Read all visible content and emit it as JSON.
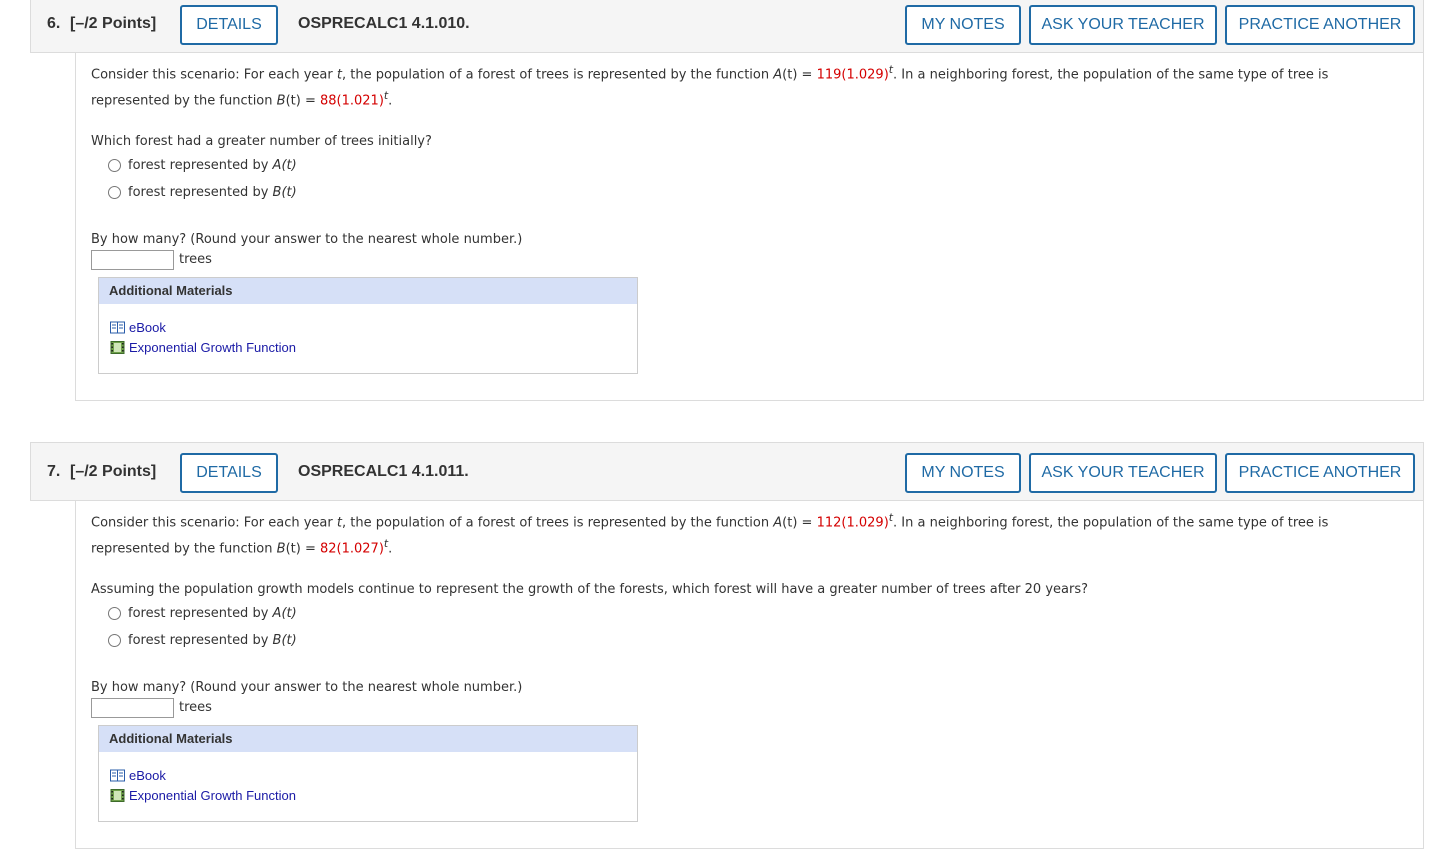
{
  "questions": [
    {
      "number": "6.",
      "points": "[–/2 Points]",
      "details_label": "DETAILS",
      "code": "OSPRECALC1 4.1.010.",
      "my_notes_label": "MY NOTES",
      "ask_teacher_label": "ASK YOUR TEACHER",
      "practice_label": "PRACTICE ANOTHER",
      "scenario": {
        "lead": "Consider this scenario: For each year ",
        "var_t": "t",
        "mid": ", the population of a forest of trees is represented by the function ",
        "fa_name": "A",
        "fa_arg": "(t)",
        "eq": " = ",
        "fa_coef": "119",
        "fa_base": "(1.029)",
        "exp_t": "t",
        "mid2": ".  In a neighboring forest, the population of the same type of tree is",
        "line2_lead": "represented by the function  ",
        "fb_name": "B",
        "fb_arg": "(t)",
        "fb_coef": "88",
        "fb_base": "(1.021)",
        "end": "."
      },
      "prompt": "Which forest had a greater number of trees initially?",
      "options": [
        {
          "text": "forest represented by ",
          "fn": "A(t)"
        },
        {
          "text": "forest represented by ",
          "fn": "B(t)"
        }
      ],
      "how_many": "By how many? (Round your answer to the nearest whole number.)",
      "answer_value": "",
      "unit": "trees",
      "additional_title": "Additional Materials",
      "materials": [
        {
          "label": "eBook",
          "icon": "book-icon"
        },
        {
          "label": "Exponential Growth Function",
          "icon": "film-icon"
        }
      ]
    },
    {
      "number": "7.",
      "points": "[–/2 Points]",
      "details_label": "DETAILS",
      "code": "OSPRECALC1 4.1.011.",
      "my_notes_label": "MY NOTES",
      "ask_teacher_label": "ASK YOUR TEACHER",
      "practice_label": "PRACTICE ANOTHER",
      "scenario": {
        "lead": "Consider this scenario: For each year ",
        "var_t": "t",
        "mid": ", the population of a forest of trees is represented by the function ",
        "fa_name": "A",
        "fa_arg": "(t)",
        "eq": " = ",
        "fa_coef": "112",
        "fa_base": "(1.029)",
        "exp_t": "t",
        "mid2": ".  In a neighboring forest, the population of the same type of tree is",
        "line2_lead": "represented by the function  ",
        "fb_name": "B",
        "fb_arg": "(t)",
        "fb_coef": "82",
        "fb_base": "(1.027)",
        "end": "."
      },
      "prompt": "Assuming the population growth models continue to represent the growth of the forests, which forest will have a greater number of trees after 20 years?",
      "options": [
        {
          "text": "forest represented by ",
          "fn": "A(t)"
        },
        {
          "text": "forest represented by ",
          "fn": "B(t)"
        }
      ],
      "how_many": "By how many? (Round your answer to the nearest whole number.)",
      "answer_value": "",
      "unit": "trees",
      "additional_title": "Additional Materials",
      "materials": [
        {
          "label": "eBook",
          "icon": "book-icon"
        },
        {
          "label": "Exponential Growth Function",
          "icon": "film-icon"
        }
      ]
    }
  ],
  "colors": {
    "accent": "#1f6aa5",
    "highlight": "#d40000",
    "materials_header": "#d6e0f7",
    "link": "#1a1aa6"
  }
}
